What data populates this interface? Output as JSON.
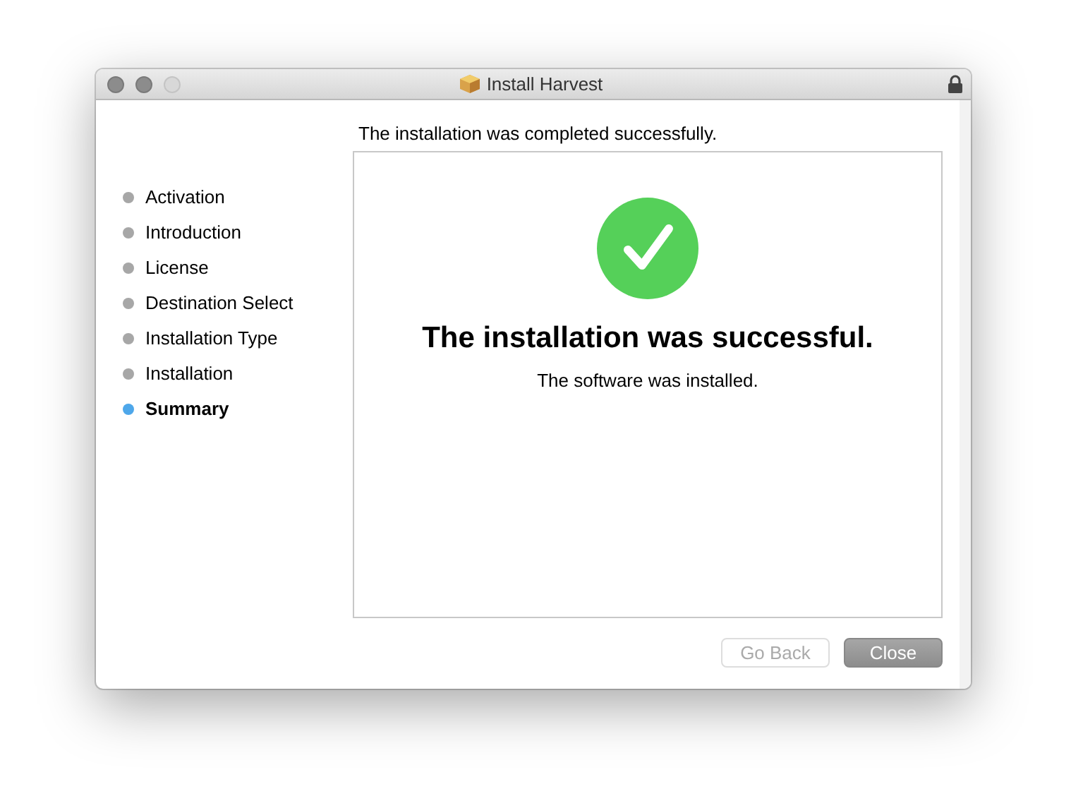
{
  "window": {
    "title": "Install Harvest"
  },
  "steps": [
    {
      "label": "Activation",
      "selected": false
    },
    {
      "label": "Introduction",
      "selected": false
    },
    {
      "label": "License",
      "selected": false
    },
    {
      "label": "Destination Select",
      "selected": false
    },
    {
      "label": "Installation Type",
      "selected": false
    },
    {
      "label": "Installation",
      "selected": false
    },
    {
      "label": "Summary",
      "selected": true
    }
  ],
  "header": "The installation was completed successfully.",
  "result": {
    "headline": "The installation was successful.",
    "message": "The software was installed."
  },
  "buttons": [
    {
      "label": "Go Back",
      "disabled": true,
      "default": false
    },
    {
      "label": "Close",
      "disabled": false,
      "default": true
    }
  ]
}
